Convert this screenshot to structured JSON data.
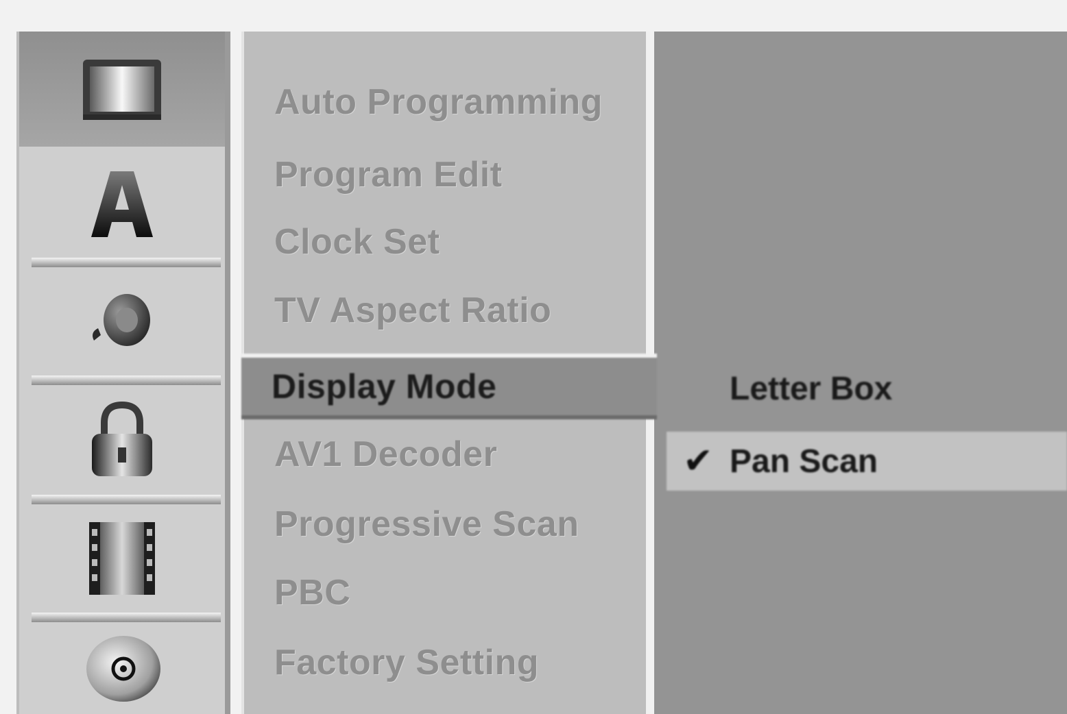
{
  "settings_menu": {
    "categories": [
      {
        "icon": "general-icon",
        "active": true
      },
      {
        "icon": "language-icon"
      },
      {
        "icon": "audio-icon"
      },
      {
        "icon": "lock-icon"
      },
      {
        "icon": "recording-icon"
      },
      {
        "icon": "disc-icon"
      }
    ],
    "items": [
      {
        "label": "Auto Programming"
      },
      {
        "label": "Program Edit"
      },
      {
        "label": "Clock Set"
      },
      {
        "label": "TV Aspect Ratio"
      },
      {
        "label": "Display Mode",
        "selected": true
      },
      {
        "label": "AV1 Decoder"
      },
      {
        "label": "Progressive Scan"
      },
      {
        "label": "PBC"
      },
      {
        "label": "Factory Setting"
      }
    ],
    "options": [
      {
        "label": "Letter Box",
        "checked": false
      },
      {
        "label": "Pan Scan",
        "checked": true,
        "check_symbol": "✔"
      }
    ]
  }
}
